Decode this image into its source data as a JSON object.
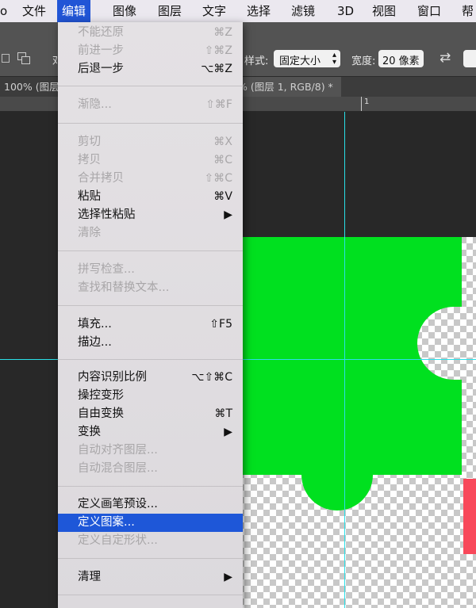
{
  "menubar": {
    "items": [
      {
        "label": "o"
      },
      {
        "label": "文件"
      },
      {
        "label": "编辑"
      },
      {
        "label": "图像"
      },
      {
        "label": "图层"
      },
      {
        "label": "文字"
      },
      {
        "label": "选择"
      },
      {
        "label": "滤镜"
      },
      {
        "label": "3D"
      },
      {
        "label": "视图"
      },
      {
        "label": "窗口"
      },
      {
        "label": "帮"
      }
    ],
    "active_index": 2
  },
  "options_bar": {
    "partial_label": "邓",
    "style_label": "样式:",
    "style_value": "固定大小",
    "width_label": "宽度:",
    "width_value": "20 像素",
    "swap_icon": "swap-arrows-icon"
  },
  "tabs": [
    {
      "label": "100% (图层"
    },
    {
      "label": "% (图层 1, RGB/8) *"
    }
  ],
  "ruler": {
    "mark": "1"
  },
  "canvas": {
    "colors": {
      "piece": "#00e01f",
      "pink": "#f8485a",
      "guide": "#2ae0e8",
      "checker": "#c8c8c8"
    }
  },
  "edit_menu": {
    "items": [
      {
        "label": "不能还原",
        "shortcut": "⌘Z",
        "disabled": true
      },
      {
        "label": "前进一步",
        "shortcut": "⇧⌘Z",
        "disabled": true
      },
      {
        "label": "后退一步",
        "shortcut": "⌥⌘Z",
        "disabled": false
      },
      {
        "label": "渐隐...",
        "shortcut": "⇧⌘F",
        "disabled": true
      },
      {
        "label": "剪切",
        "shortcut": "⌘X",
        "disabled": true
      },
      {
        "label": "拷贝",
        "shortcut": "⌘C",
        "disabled": true
      },
      {
        "label": "合并拷贝",
        "shortcut": "⇧⌘C",
        "disabled": true
      },
      {
        "label": "粘贴",
        "shortcut": "⌘V",
        "disabled": false
      },
      {
        "label": "选择性粘贴",
        "shortcut": "▶",
        "disabled": false
      },
      {
        "label": "清除",
        "shortcut": "",
        "disabled": true
      },
      {
        "label": "拼写检查...",
        "shortcut": "",
        "disabled": true
      },
      {
        "label": "查找和替换文本...",
        "shortcut": "",
        "disabled": true
      },
      {
        "label": "填充...",
        "shortcut": "⇧F5",
        "disabled": false
      },
      {
        "label": "描边...",
        "shortcut": "",
        "disabled": false
      },
      {
        "label": "内容识别比例",
        "shortcut": "⌥⇧⌘C",
        "disabled": false
      },
      {
        "label": "操控变形",
        "shortcut": "",
        "disabled": false
      },
      {
        "label": "自由变换",
        "shortcut": "⌘T",
        "disabled": false
      },
      {
        "label": "变换",
        "shortcut": "▶",
        "disabled": false
      },
      {
        "label": "自动对齐图层...",
        "shortcut": "",
        "disabled": true
      },
      {
        "label": "自动混合图层...",
        "shortcut": "",
        "disabled": true
      },
      {
        "label": "定义画笔预设...",
        "shortcut": "",
        "disabled": false
      },
      {
        "label": "定义图案...",
        "shortcut": "",
        "disabled": false,
        "highlighted": true
      },
      {
        "label": "定义自定形状...",
        "shortcut": "",
        "disabled": true
      },
      {
        "label": "清理",
        "shortcut": "▶",
        "disabled": false
      }
    ]
  }
}
